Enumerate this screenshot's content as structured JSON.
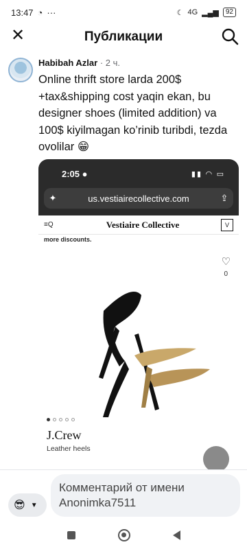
{
  "status_bar": {
    "time": "13:47",
    "icons_left": [
      "whatsapp-icon",
      "more-icon"
    ],
    "signal_label": "4G",
    "battery": "92"
  },
  "header": {
    "title": "Публикации"
  },
  "post": {
    "author": "Habibah Azlar",
    "separator": " · ",
    "time": "2 ч.",
    "text": "Online thrift store larda 200$ +tax&shipping cost yaqin ekan, bu designer shoes (limited addition) va 100$ kiyilmagan ko’rinib turibdi, tezda ovolilar 😁"
  },
  "embedded_screenshot": {
    "phone_time": "2:05",
    "url": "us.vestiairecollective.com",
    "site_logo": "Vestiaire Collective",
    "discount_text": "more discounts.",
    "likes": "0",
    "brand": "J.Crew",
    "product_name": "Leather heels"
  },
  "comment": {
    "placeholder": "Комментарий от имени Anonimka7511"
  }
}
